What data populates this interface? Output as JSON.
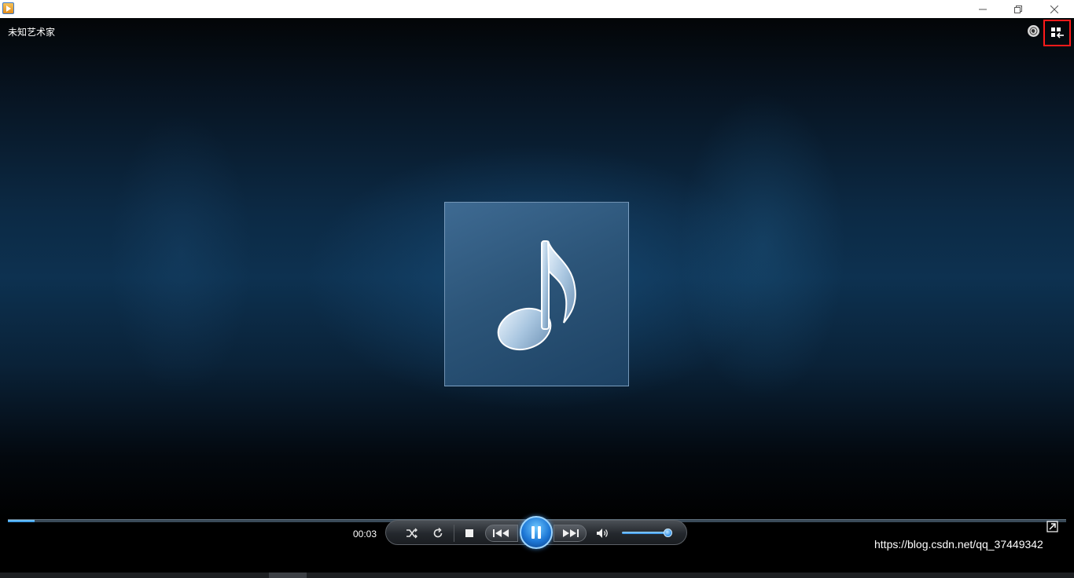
{
  "titlebar": {
    "app_icon": "media-player-icon",
    "buttons": {
      "minimize": "minimize-icon",
      "restore": "restore-icon",
      "close": "close-icon"
    }
  },
  "player": {
    "artist": "未知艺术家",
    "album_art_icon": "music-note-icon",
    "top_controls": {
      "online_icon": "globe-icon",
      "switch_to_library_icon": "switch-to-library-icon"
    }
  },
  "playback": {
    "elapsed_time": "00:03",
    "progress_fraction": 0.025,
    "volume_fraction": 0.92,
    "state": "playing",
    "controls": [
      "shuffle-icon",
      "repeat-icon",
      "stop-icon",
      "previous-icon",
      "pause-icon",
      "next-icon",
      "volume-icon"
    ]
  },
  "watermark": {
    "text": "https://blog.csdn.net/qq_37449342"
  },
  "colors": {
    "accent": "#2a8de0",
    "highlight_box": "#ff1a1a"
  }
}
